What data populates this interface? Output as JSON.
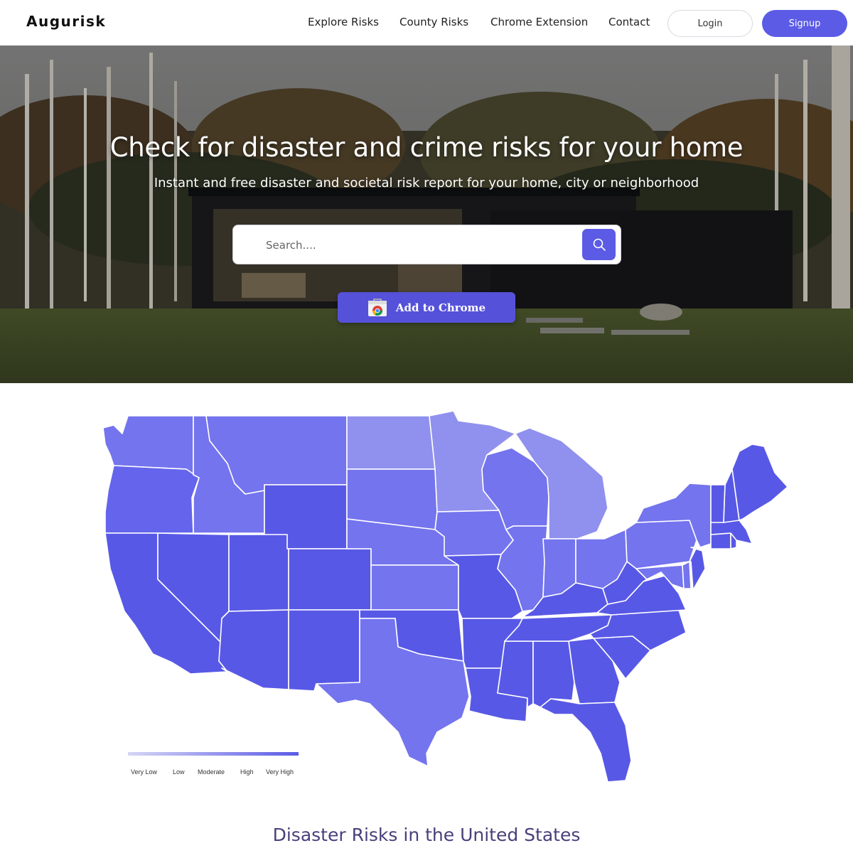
{
  "header": {
    "logo": "Augurisk",
    "nav": [
      "Explore Risks",
      "County Risks",
      "Chrome Extension",
      "Contact"
    ],
    "login_label": "Login",
    "signup_label": "Signup"
  },
  "hero": {
    "title": "Check for disaster and crime risks for your home",
    "subtitle": "Instant and free disaster and societal risk report for your home, city or neighborhood",
    "search_placeholder": "Search....",
    "chrome_button_label": "Add to Chrome"
  },
  "map": {
    "legend": [
      "Very Low",
      "Low",
      "Moderate",
      "High",
      "Very High"
    ],
    "colors": {
      "very_low": "#d6d6f6",
      "low": "#9090ee",
      "moderate": "#7474ee",
      "high": "#6464ec",
      "very_high": "#5858e6"
    }
  },
  "section": {
    "title": "Disaster Risks in the United States"
  },
  "theme": {
    "accent": "#5b5be6"
  }
}
